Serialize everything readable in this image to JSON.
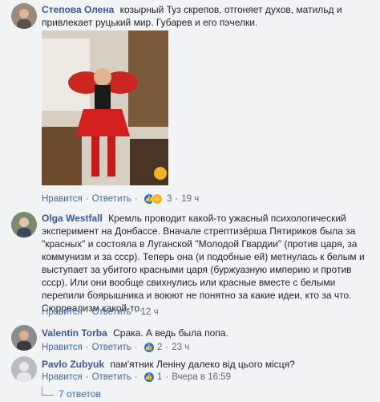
{
  "comments": [
    {
      "author": "Степова Олена",
      "text": "козырный Туз скрепов, отгоняет духов, матильд и привлекает руцький мир. Губарев и его пэчелки.",
      "actions": {
        "like": "Нравится",
        "reply": "Ответить",
        "reaction_count": "3",
        "time": "19 ч"
      }
    },
    {
      "author": "Olga Westfall",
      "text": "Кремль проводит какой-то ужасный психологический эксперимент на Донбассе. Вначале стрептизёрша Пятириков была за \"красных\" и состояла в Луганской \"Молодой Гвардии\" (против царя, за коммунизм и за ссср). Теперь она (и подобные ей) метнулась к белым и выступает за убитого красными царя (буржуазную империю и против ссср). Или они вообще свихнулись или красные вместе с белыми перепили боярышника и воюют не понятно за какие идеи, кто за что. Сюрреализм какой-то.",
      "actions": {
        "like": "Нравится",
        "reply": "Ответить",
        "time": "12 ч"
      }
    },
    {
      "author": "Valentin Torba",
      "text": "Срака. А ведь была попа.",
      "actions": {
        "like": "Нравится",
        "reply": "Ответить",
        "reaction_count": "2",
        "time": "23 ч"
      }
    },
    {
      "author": "Pavlo Zubyuk",
      "text": "пам'ятник Леніну далеко від цього місця?",
      "actions": {
        "like": "Нравится",
        "reply": "Ответить",
        "reaction_count": "1",
        "time": "Вчера в 16:59"
      }
    }
  ],
  "replies_link": "7 ответов",
  "colors": {
    "link": "#385898",
    "action": "#4267b2",
    "like": "#1877f2",
    "haha": "#f7b125",
    "love": "#f33e58"
  }
}
